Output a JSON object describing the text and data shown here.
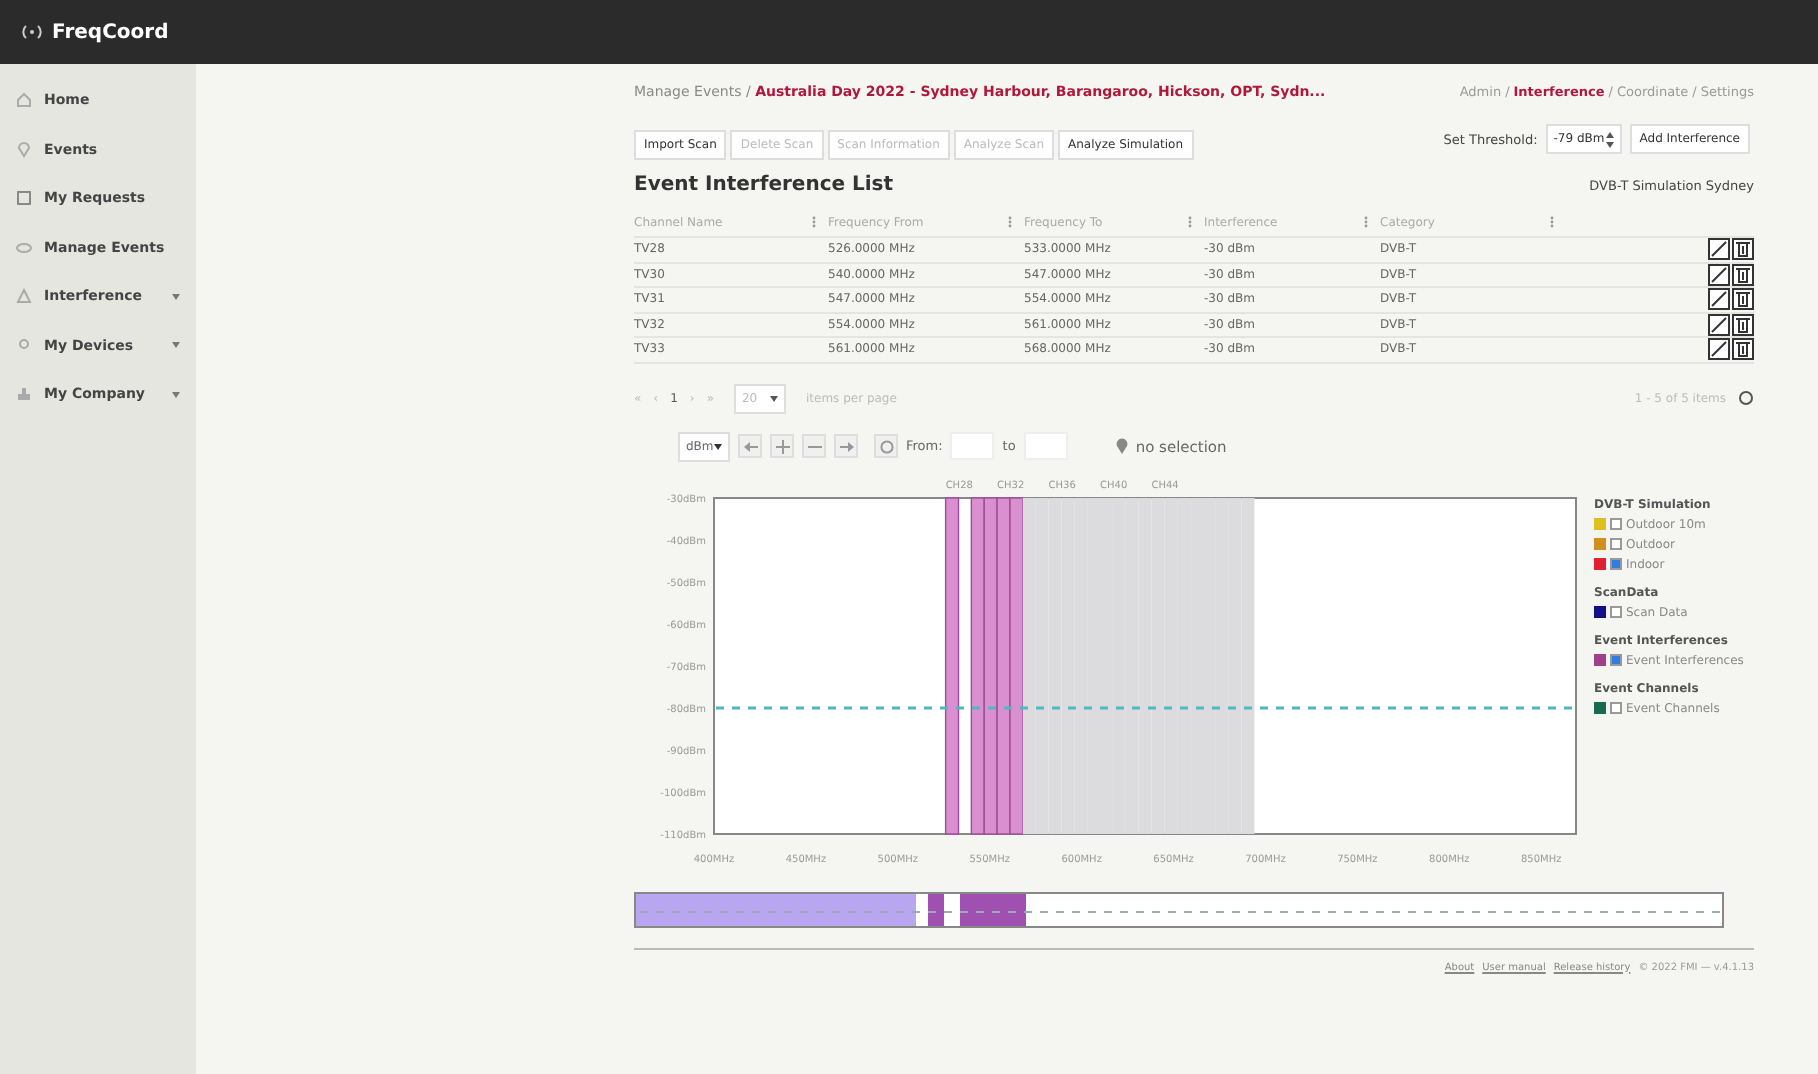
{
  "app": {
    "title": "FreqCoord"
  },
  "sidebar": {
    "items": [
      {
        "label": "Home",
        "expandable": false
      },
      {
        "label": "Events",
        "expandable": false
      },
      {
        "label": "My Requests",
        "expandable": false
      },
      {
        "label": "Manage Events",
        "expandable": false
      },
      {
        "label": "Interference",
        "expandable": true
      },
      {
        "label": "My Devices",
        "expandable": true
      },
      {
        "label": "My Company",
        "expandable": true
      }
    ]
  },
  "breadcrumb": {
    "parent": "Manage Events",
    "separator": "/",
    "current": "Australia Day 2022 - Sydney Harbour, Barangaroo, Hickson, OPT, Sydn..."
  },
  "tab_separator": "/",
  "tabs": [
    {
      "label": "Admin",
      "selected": false
    },
    {
      "label": "Interference",
      "selected": true
    },
    {
      "label": "Coordinate",
      "selected": false
    },
    {
      "label": "Settings",
      "selected": false
    }
  ],
  "toolbar": [
    {
      "label": "Import Scan",
      "disabled": false
    },
    {
      "label": "Delete Scan",
      "disabled": true
    },
    {
      "label": "Scan Information",
      "disabled": true
    },
    {
      "label": "Analyze Scan",
      "disabled": true
    },
    {
      "label": "Analyze Simulation",
      "disabled": false
    }
  ],
  "threshold": {
    "label": "Set Threshold:",
    "value": "-79 dBm"
  },
  "add_button": "Add Interference",
  "list_title": "Event Interference List",
  "simulation_name": "DVB-T Simulation Sydney",
  "table": {
    "columns": [
      "Channel Name",
      "Frequency From",
      "Frequency To",
      "Interference",
      "Category"
    ],
    "rows": [
      [
        "TV28",
        "526.0000 MHz",
        "533.0000 MHz",
        "-30 dBm",
        "DVB-T"
      ],
      [
        "TV30",
        "540.0000 MHz",
        "547.0000 MHz",
        "-30 dBm",
        "DVB-T"
      ],
      [
        "TV31",
        "547.0000 MHz",
        "554.0000 MHz",
        "-30 dBm",
        "DVB-T"
      ],
      [
        "TV32",
        "554.0000 MHz",
        "561.0000 MHz",
        "-30 dBm",
        "DVB-T"
      ],
      [
        "TV33",
        "561.0000 MHz",
        "568.0000 MHz",
        "-30 dBm",
        "DVB-T"
      ]
    ]
  },
  "pagination": {
    "first": "«",
    "prev": "‹",
    "page": "1",
    "next": "›",
    "last": "»",
    "page_size": "20",
    "page_size_label": "items per page",
    "summary": "1 - 5 of 5 items"
  },
  "chart_controls": {
    "unit": "dBm",
    "from_label": "From:",
    "to_label": "to",
    "selection": "no selection"
  },
  "chart_data": {
    "type": "bar",
    "xlim": [
      400,
      870
    ],
    "ylim": [
      -110,
      -30
    ],
    "yticks": [
      {
        "value": -30,
        "label": "-30dBm"
      },
      {
        "value": -40,
        "label": "-40dBm"
      },
      {
        "value": -50,
        "label": "-50dBm"
      },
      {
        "value": -60,
        "label": "-60dBm"
      },
      {
        "value": -70,
        "label": "-70dBm"
      },
      {
        "value": -80,
        "label": "-80dBm"
      },
      {
        "value": -90,
        "label": "-90dBm"
      },
      {
        "value": -100,
        "label": "-100dBm"
      },
      {
        "value": -110,
        "label": "-110dBm"
      }
    ],
    "xticks": [
      {
        "value": 400,
        "label": "400MHz"
      },
      {
        "value": 450,
        "label": "450MHz"
      },
      {
        "value": 500,
        "label": "500MHz"
      },
      {
        "value": 550,
        "label": "550MHz"
      },
      {
        "value": 600,
        "label": "600MHz"
      },
      {
        "value": 650,
        "label": "650MHz"
      },
      {
        "value": 700,
        "label": "700MHz"
      },
      {
        "value": 750,
        "label": "750MHz"
      },
      {
        "value": 800,
        "label": "800MHz"
      },
      {
        "value": 850,
        "label": "850MHz"
      }
    ],
    "bands": [
      {
        "axis": "x",
        "from": 526,
        "to": 533,
        "color": "#d98fd0"
      },
      {
        "axis": "x",
        "from": 540,
        "to": 547,
        "color": "#d98fd0"
      },
      {
        "axis": "x",
        "from": 547,
        "to": 554,
        "color": "#d98fd0"
      },
      {
        "axis": "x",
        "from": 554,
        "to": 561,
        "color": "#d98fd0"
      },
      {
        "axis": "x",
        "from": 561,
        "to": 568,
        "color": "#d98fd0"
      },
      {
        "axis": "x",
        "from": 568,
        "to": 575,
        "color": "#dcdcde"
      },
      {
        "axis": "x",
        "from": 575,
        "to": 582,
        "color": "#dcdcde"
      },
      {
        "axis": "x",
        "from": 582,
        "to": 589,
        "color": "#dcdcde"
      },
      {
        "axis": "x",
        "from": 589,
        "to": 596,
        "color": "#dcdcde"
      },
      {
        "axis": "x",
        "from": 596,
        "to": 603,
        "color": "#dcdcde"
      },
      {
        "axis": "x",
        "from": 603,
        "to": 610,
        "color": "#dcdcde"
      },
      {
        "axis": "x",
        "from": 610,
        "to": 617,
        "color": "#dcdcde"
      },
      {
        "axis": "x",
        "from": 617,
        "to": 624,
        "color": "#dcdcde"
      },
      {
        "axis": "x",
        "from": 624,
        "to": 631,
        "color": "#dcdcde"
      },
      {
        "axis": "x",
        "from": 631,
        "to": 638,
        "color": "#dcdcde"
      },
      {
        "axis": "x",
        "from": 638,
        "to": 645,
        "color": "#dcdcde"
      },
      {
        "axis": "x",
        "from": 645,
        "to": 652,
        "color": "#dcdcde"
      },
      {
        "axis": "x",
        "from": 652,
        "to": 659,
        "color": "#dcdcde"
      },
      {
        "axis": "x",
        "from": 659,
        "to": 666,
        "color": "#dcdcde"
      },
      {
        "axis": "x",
        "from": 666,
        "to": 673,
        "color": "#dcdcde"
      },
      {
        "axis": "x",
        "from": 673,
        "to": 680,
        "color": "#dcdcde"
      },
      {
        "axis": "x",
        "from": 680,
        "to": 687,
        "color": "#dcdcde"
      },
      {
        "axis": "x",
        "from": 687,
        "to": 694,
        "color": "#dcdcde"
      }
    ],
    "ref_lines": [
      {
        "axis": "y",
        "value": -80,
        "color": "#4fb8c0"
      }
    ]
  },
  "channel_labels": [
    "CH28",
    "CH32",
    "CH36",
    "CH40",
    "CH44"
  ],
  "legend": [
    {
      "title": "DVB-T Simulation",
      "items": [
        {
          "label": "Outdoor 10m",
          "color": "#e0c020",
          "checked": false
        },
        {
          "label": "Outdoor",
          "color": "#d09020",
          "checked": false
        },
        {
          "label": "Indoor",
          "color": "#e02030",
          "checked": true
        }
      ]
    },
    {
      "title": "ScanData",
      "items": [
        {
          "label": "Scan Data",
          "color": "#10108a",
          "checked": false
        }
      ]
    },
    {
      "title": "Event Interferences",
      "items": [
        {
          "label": "Event Interferences",
          "color": "#a0408a",
          "checked": true
        }
      ]
    },
    {
      "title": "Event Channels",
      "items": [
        {
          "label": "Event Channels",
          "color": "#1a6a50",
          "checked": false
        }
      ]
    }
  ],
  "footer": {
    "links": [
      "About",
      "User manual",
      "Release history"
    ],
    "copyright": "© 2022 FMI — v.4.1.13"
  }
}
